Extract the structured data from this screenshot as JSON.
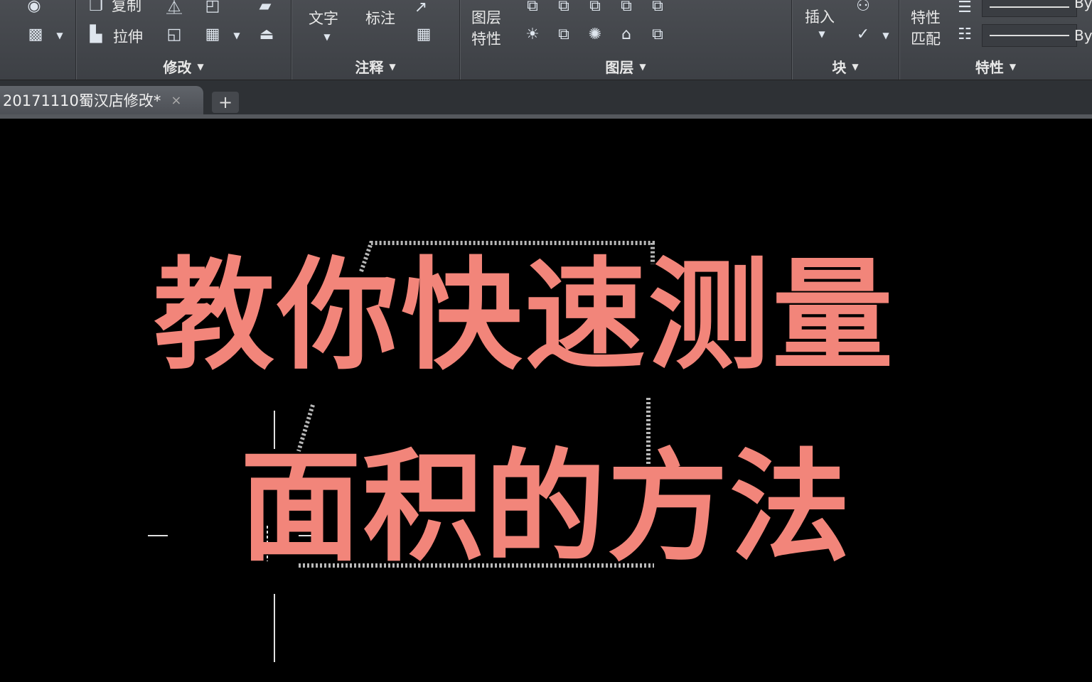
{
  "ribbon": {
    "panels": [
      {
        "id": "modify",
        "title": "修改",
        "items": {
          "copy": "复制",
          "stretch": "拉伸"
        }
      },
      {
        "id": "annotation",
        "title": "注释",
        "items": {
          "text": "文字",
          "dimension": "标注"
        }
      },
      {
        "id": "layers",
        "title": "图层",
        "items": {
          "layer_props": "图层\n特性"
        }
      },
      {
        "id": "block",
        "title": "块",
        "items": {
          "insert": "插入"
        }
      },
      {
        "id": "properties",
        "title": "特性",
        "items": {
          "match": "特性\n匹配",
          "bylayer_1": "By",
          "bylayer_2": "By"
        }
      }
    ]
  },
  "tabs": {
    "document": "20171110蜀汉店修改*",
    "close_glyph": "×",
    "add_glyph": "+"
  },
  "overlay": {
    "line1": "教你快速测量",
    "line2": "面积的方法"
  },
  "colors": {
    "overlay_text": "#f2857a",
    "ribbon_bg": "#45484d",
    "canvas_bg": "#000000"
  }
}
